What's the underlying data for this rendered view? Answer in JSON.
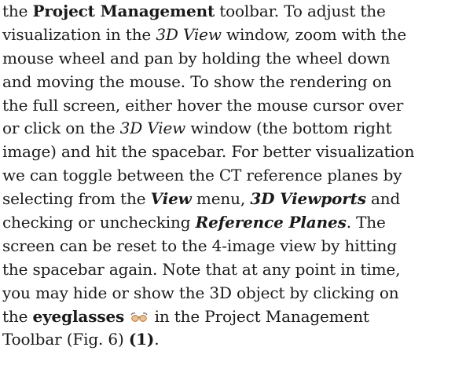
{
  "paragraph": {
    "l1": {
      "a": "the ",
      "b": "Project Management",
      "c": " toolbar. To adjust the"
    },
    "l2": {
      "a": "visualization in the ",
      "b": "3D View",
      "c": " window, zoom with the"
    },
    "l3": {
      "a": "mouse wheel and pan by holding the wheel down"
    },
    "l4": {
      "a": "and moving the mouse. To show the rendering on"
    },
    "l5": {
      "a": "the full screen, either hover the mouse cursor over"
    },
    "l6": {
      "a": "or click on the ",
      "b": "3D View",
      "c": " window (the bottom right"
    },
    "l7": {
      "a": "image) and hit the spacebar. For better visualization"
    },
    "l8": {
      "a": "we can toggle between the CT reference planes by"
    },
    "l9": {
      "a": "selecting from the ",
      "b": "View",
      "c": " menu, ",
      "d": "3D Viewports",
      "e": " and"
    },
    "l10": {
      "a": "checking or unchecking ",
      "b": "Reference Planes",
      "c": ". The"
    },
    "l11": {
      "a": "screen can be reset to the 4-image view by hitting"
    },
    "l12": {
      "a": "the spacebar again. Note that at any point in time,"
    },
    "l13": {
      "a": "you may hide or show the 3D object by clicking on"
    },
    "l14": {
      "a": "the ",
      "b": "eyeglasses",
      "c": " in the Project Management"
    },
    "l15": {
      "a": "Toolbar (Fig. 6) ",
      "b": "(1)",
      "c": "."
    }
  },
  "icons": {
    "eyeglasses": "eyeglasses-icon"
  },
  "colors": {
    "text": "#1a1a1a",
    "icon_lens": "#c98a4b",
    "icon_frame": "#6b6b6b"
  }
}
